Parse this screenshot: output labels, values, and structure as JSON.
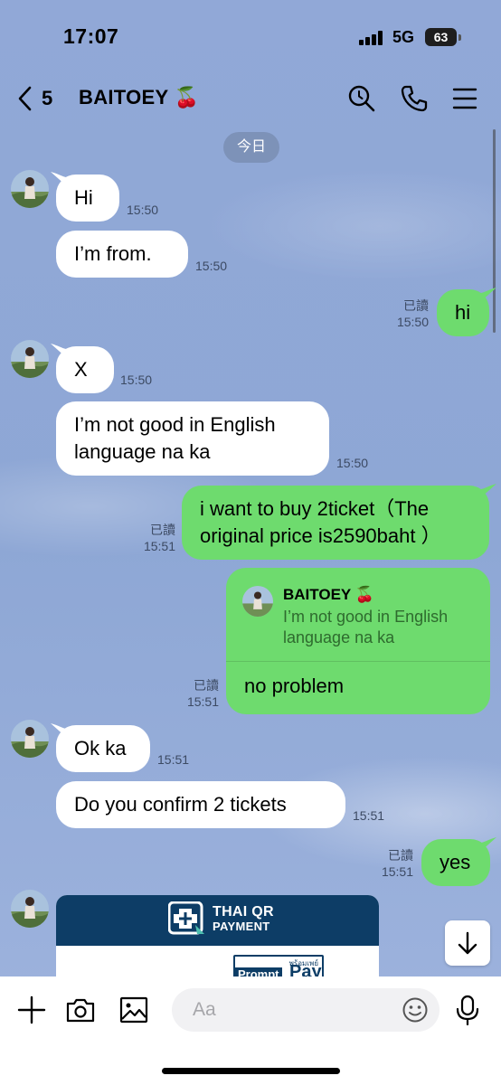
{
  "status_bar": {
    "time": "17:07",
    "network": "5G",
    "battery": "63"
  },
  "header": {
    "back_count": "5",
    "title": "BAITOEY 🍒"
  },
  "date_chip": "今日",
  "messages": [
    {
      "side": "in",
      "text": "Hi",
      "time": "15:50"
    },
    {
      "side": "in",
      "text": "I’m from.",
      "time": "15:50"
    },
    {
      "side": "out",
      "text": "hi",
      "read": "已讀",
      "time": "15:50"
    },
    {
      "side": "in",
      "text": "X",
      "time": "15:50"
    },
    {
      "side": "in",
      "text_lines": [
        "I’m not good in English",
        "language na ka"
      ],
      "time": "15:50"
    },
    {
      "side": "out",
      "text_lines": [
        "i want to buy 2ticket（The",
        "original price is2590baht ）"
      ],
      "read": "已讀",
      "time": "15:51"
    },
    {
      "side": "out",
      "reply_to_name": "BAITOEY 🍒",
      "reply_to_lines": [
        "I’m not good in English",
        "language na ka"
      ],
      "text": "no problem",
      "read": "已讀",
      "time": "15:51"
    },
    {
      "side": "in",
      "text": "Ok ka",
      "time": "15:51"
    },
    {
      "side": "in",
      "text": "Do you confirm 2 tickets",
      "time": "15:51"
    },
    {
      "side": "out",
      "text": "yes",
      "read": "已讀",
      "time": "15:51"
    }
  ],
  "qr_card": {
    "line1": "THAI QR",
    "line2": "PAYMENT",
    "prompt": "Prompt",
    "pay": "Pay",
    "thai": "พร้อมเพย์"
  },
  "composer": {
    "placeholder": "Aa"
  },
  "colors": {
    "background": "#8fa8d6",
    "outgoing_bubble": "#6edb6e",
    "incoming_bubble": "#ffffff",
    "qr_blue": "#0d3d66"
  },
  "icons": [
    "back-chevron-icon",
    "search-icon",
    "phone-icon",
    "menu-icon",
    "plus-icon",
    "camera-icon",
    "image-icon",
    "emoji-icon",
    "mic-icon",
    "arrow-down-icon"
  ]
}
